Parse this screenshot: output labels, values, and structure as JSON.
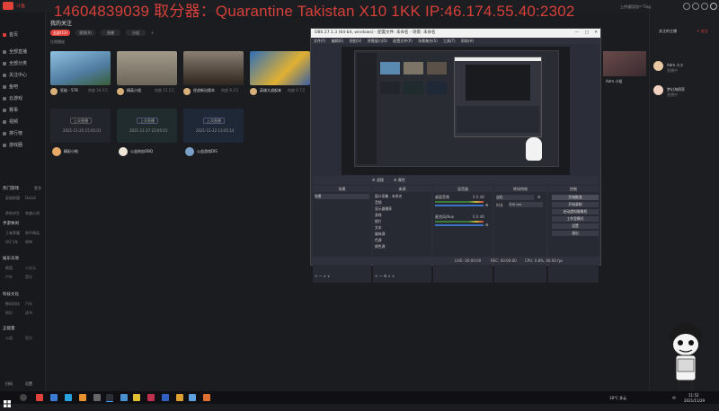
{
  "overlay_banner": "14604839039  取分器：Quarantine Takistan X10 1KK  IP:46.174.55.40:2302",
  "app": {
    "logo_text": "斗鱼",
    "brand_color": "#e0423b",
    "top_right_text": "上传通用用户  Ting"
  },
  "left_nav": {
    "items": [
      {
        "label": "首页",
        "icon": "home-icon"
      },
      {
        "label": "全部直播",
        "icon": "live-icon"
      },
      {
        "label": "全部分类",
        "icon": "category-icon"
      },
      {
        "label": "关注中心",
        "icon": "follow-icon"
      },
      {
        "label": "鱼吧",
        "icon": "fish-icon"
      },
      {
        "label": "云游戏",
        "icon": "game-icon"
      },
      {
        "label": "赛事",
        "icon": "trophy-icon"
      },
      {
        "label": "视频",
        "icon": "video-icon"
      },
      {
        "label": "排行榜",
        "icon": "rank-icon"
      },
      {
        "label": "游戏圈",
        "icon": "circle-icon"
      }
    ],
    "sections": [
      {
        "title": "热门游戏",
        "more": "更多",
        "subs": [
          "英雄联盟",
          "Dota2",
          "绝地求生",
          "穿越火线"
        ]
      },
      {
        "title": "手游休闲",
        "more": "",
        "subs": [
          "王者荣耀",
          "和平精英",
          "QQ飞车",
          "原神"
        ]
      },
      {
        "title": "娱乐天地",
        "more": "",
        "subs": [
          "颜值",
          "二次元",
          "户外",
          "音乐"
        ]
      },
      {
        "title": "科技文化",
        "more": "",
        "subs": [
          "数码科技",
          "汽车",
          "知识",
          "读书"
        ]
      },
      {
        "title": "正能量",
        "more": "",
        "subs": [
          "公益",
          "官方"
        ]
      }
    ],
    "bottom": [
      "扫码",
      "设置"
    ]
  },
  "main": {
    "section_title": "我的关注",
    "tabs": [
      "全部(12)",
      "视频(0)",
      "直播",
      "分组"
    ],
    "subline": "往期播放",
    "cards_row1": [
      {
        "title": "狂徒 - 578",
        "meta": "热度 34.5万",
        "thumb_color": "#5a8ab0"
      },
      {
        "title": "精英小组",
        "meta": "热度 12.1万",
        "thumb_color": "#7c7466"
      },
      {
        "title": "逆战新出版本",
        "meta": "热度 8.2万",
        "thumb_color": "#5c5148"
      },
      {
        "title": "英雄大战起来",
        "meta": "热度 6.7万",
        "thumb_color": "#4a7ab0"
      }
    ],
    "cards_row2": [
      {
        "title": "精彩小枪",
        "date": "2021-11-25 15:05:01",
        "badge": "上次直播"
      },
      {
        "title": "公益热血OBQ",
        "date": "2021-11-27 23:05:01",
        "badge": "上次直播"
      },
      {
        "title": "公益游戏DIS",
        "date": "2021-11-22 13:05:14",
        "badge": "上次直播"
      }
    ]
  },
  "right_bar": {
    "title": "关注的主播",
    "action": "+ 关注",
    "live_title": "Adm 小组",
    "items": [
      {
        "name": "Adm 小小",
        "sub": "直播中"
      },
      {
        "name": "梦幻海鸥家",
        "sub": "直播中"
      }
    ]
  },
  "obs": {
    "title": "OBS 27.1.3 (64-bit, windows) - 配置文件: 未命名 - 场景: 未命名",
    "menu": [
      "文件(F)",
      "编辑(E)",
      "视图(V)",
      "停靠窗口(D)",
      "配置文件(P)",
      "场景集合(S)",
      "工具(T)",
      "帮助(H)"
    ],
    "docks": {
      "scenes": {
        "title": "场景",
        "items": [
          "场景"
        ]
      },
      "sources": {
        "title": "来源",
        "items": [
          "窗口采集 - 未命名",
          "音频",
          "显示器捕获",
          "游戏",
          "图片",
          "文本",
          "媒体源",
          "色源",
          "颜色源"
        ]
      },
      "mixer": {
        "title": "混音器",
        "tracks": [
          {
            "name": "桌面音频",
            "db": "0.0 dB"
          },
          {
            "name": "麦克风/Aux",
            "db": "0.0 dB"
          }
        ]
      },
      "transitions": {
        "title": "转场特效",
        "type": "淡化",
        "duration_label": "时长",
        "duration": "300 ms"
      },
      "controls": {
        "title": "控制",
        "buttons": [
          "开始推流",
          "开始录制",
          "启动虚拟摄像机",
          "工作室模式",
          "设置",
          "退出"
        ]
      }
    },
    "status": {
      "live": "LIVE: 00:00:00",
      "rec": "REC: 00:00:00",
      "cpu": "CPU: 0.8%, 60.00 fps"
    }
  },
  "taskbar": {
    "time": "11:52",
    "date": "2021/11/29",
    "weather": "18°C 多云",
    "lang": "中"
  }
}
